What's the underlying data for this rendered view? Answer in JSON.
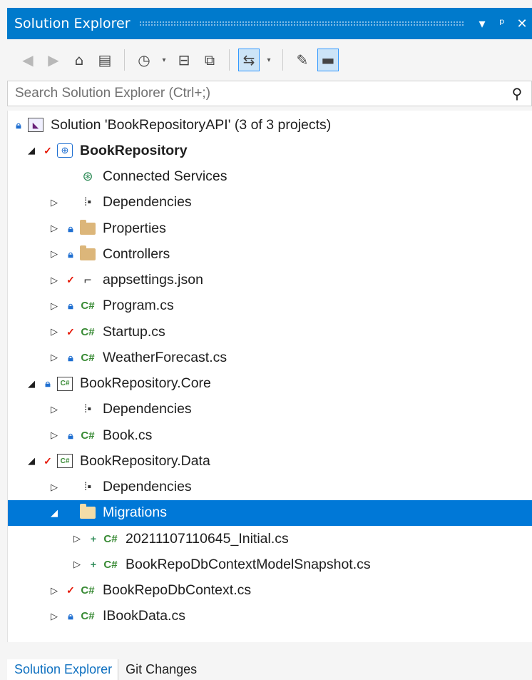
{
  "window": {
    "title": "Solution Explorer",
    "dropdown_icon": "▾",
    "pin_icon": "ᵖ",
    "close_icon": "✕"
  },
  "toolbar": {
    "buttons": [
      {
        "name": "back-button",
        "icon": "◀",
        "enabled": false
      },
      {
        "name": "forward-button",
        "icon": "▶",
        "enabled": false
      },
      {
        "name": "home-button",
        "icon": "⌂",
        "enabled": true
      },
      {
        "name": "switch-views-button",
        "icon": "▤",
        "enabled": true
      },
      {
        "name": "pending-changes-filter-button",
        "icon": "◷",
        "enabled": true
      },
      {
        "name": "collapse-all-button",
        "icon": "⊟",
        "enabled": true
      },
      {
        "name": "show-all-files-button",
        "icon": "⧉",
        "enabled": true
      },
      {
        "name": "sync-active-document-button",
        "icon": "⇆",
        "enabled": true
      },
      {
        "name": "properties-button",
        "icon": "✎",
        "enabled": true
      },
      {
        "name": "preview-selected-button",
        "icon": "▬",
        "enabled": true
      }
    ]
  },
  "search": {
    "placeholder": "Search Solution Explorer (Ctrl+;)",
    "value": ""
  },
  "tree": [
    {
      "label": "Solution 'BookRepositoryAPI' (3 of 3 projects)",
      "indent": 0,
      "expander": "",
      "state": "lock",
      "icon": "solution",
      "bold": false,
      "selected": false
    },
    {
      "label": "BookRepository",
      "indent": 1,
      "expander": "expanded",
      "state": "check",
      "icon": "web-project",
      "bold": true,
      "selected": false
    },
    {
      "label": "Connected Services",
      "indent": 2,
      "expander": "",
      "state": "",
      "icon": "connected-services",
      "bold": false,
      "selected": false
    },
    {
      "label": "Dependencies",
      "indent": 2,
      "expander": "collapsed",
      "state": "",
      "icon": "dependencies",
      "bold": false,
      "selected": false
    },
    {
      "label": "Properties",
      "indent": 2,
      "expander": "collapsed",
      "state": "lock",
      "icon": "properties-folder",
      "bold": false,
      "selected": false
    },
    {
      "label": "Controllers",
      "indent": 2,
      "expander": "collapsed",
      "state": "lock",
      "icon": "folder",
      "bold": false,
      "selected": false
    },
    {
      "label": "appsettings.json",
      "indent": 2,
      "expander": "collapsed",
      "state": "check",
      "icon": "json",
      "bold": false,
      "selected": false
    },
    {
      "label": "Program.cs",
      "indent": 2,
      "expander": "collapsed",
      "state": "lock",
      "icon": "csharp",
      "bold": false,
      "selected": false
    },
    {
      "label": "Startup.cs",
      "indent": 2,
      "expander": "collapsed",
      "state": "check",
      "icon": "csharp",
      "bold": false,
      "selected": false
    },
    {
      "label": "WeatherForecast.cs",
      "indent": 2,
      "expander": "collapsed",
      "state": "lock",
      "icon": "csharp",
      "bold": false,
      "selected": false
    },
    {
      "label": "BookRepository.Core",
      "indent": 1,
      "expander": "expanded",
      "state": "lock",
      "icon": "csproj",
      "bold": false,
      "selected": false
    },
    {
      "label": "Dependencies",
      "indent": 2,
      "expander": "collapsed",
      "state": "",
      "icon": "dependencies",
      "bold": false,
      "selected": false
    },
    {
      "label": "Book.cs",
      "indent": 2,
      "expander": "collapsed",
      "state": "lock",
      "icon": "csharp",
      "bold": false,
      "selected": false
    },
    {
      "label": "BookRepository.Data",
      "indent": 1,
      "expander": "expanded",
      "state": "check",
      "icon": "csproj",
      "bold": false,
      "selected": false
    },
    {
      "label": "Dependencies",
      "indent": 2,
      "expander": "collapsed",
      "state": "",
      "icon": "dependencies",
      "bold": false,
      "selected": false
    },
    {
      "label": "Migrations",
      "indent": 2,
      "expander": "expanded",
      "state": "",
      "icon": "folder-open",
      "bold": false,
      "selected": true
    },
    {
      "label": "20211107110645_Initial.cs",
      "indent": 3,
      "expander": "collapsed",
      "state": "add",
      "icon": "csharp",
      "bold": false,
      "selected": false
    },
    {
      "label": "BookRepoDbContextModelSnapshot.cs",
      "indent": 3,
      "expander": "collapsed",
      "state": "add",
      "icon": "csharp",
      "bold": false,
      "selected": false
    },
    {
      "label": "BookRepoDbContext.cs",
      "indent": 2,
      "expander": "collapsed",
      "state": "check",
      "icon": "csharp",
      "bold": false,
      "selected": false
    },
    {
      "label": "IBookData.cs",
      "indent": 2,
      "expander": "collapsed",
      "state": "lock",
      "icon": "csharp",
      "bold": false,
      "selected": false
    }
  ],
  "bottom_tabs": [
    {
      "label": "Solution Explorer",
      "active": true
    },
    {
      "label": "Git Changes",
      "active": false
    }
  ]
}
